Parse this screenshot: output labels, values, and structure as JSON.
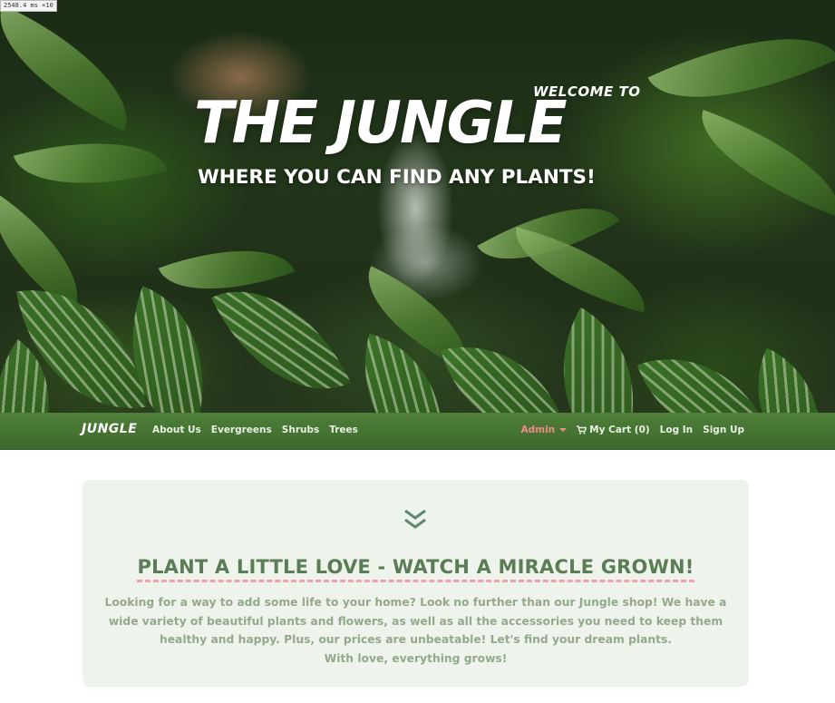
{
  "dev_badge": "2548.4 ms ×10",
  "hero": {
    "welcome": "WELCOME TO",
    "title": "THE JUNGLE",
    "subtitle": "WHERE YOU CAN FIND ANY PLANTS!"
  },
  "navbar": {
    "brand": "JUNGLE",
    "left_links": [
      "About Us",
      "Evergreens",
      "Shrubs",
      "Trees"
    ],
    "admin": "Admin",
    "cart": "My Cart (0)",
    "login": "Log In",
    "signup": "Sign Up"
  },
  "intro": {
    "headline": "PLANT A LITTLE LOVE - WATCH A MIRACLE GROWN!",
    "body": "Looking for a way to add some life to your home? Look no further than our Jungle shop! We have a wide variety of beautiful plants and flowers, as well as all the accessories you need to keep them healthy and happy. Plus, our prices are unbeatable! Let's find your dream plants.",
    "signoff": "With love, everything grows!"
  },
  "colors": {
    "navbar_green": "#4f7f3a",
    "admin_pink": "#f08a8a",
    "card_background": "#eef3ec",
    "headline_green": "#5a7d56",
    "underline_pink": "#efa1ad",
    "body_text": "#93a98c"
  },
  "icons": [
    "double-chevron-down-icon",
    "cart-icon",
    "caret-down-icon"
  ]
}
